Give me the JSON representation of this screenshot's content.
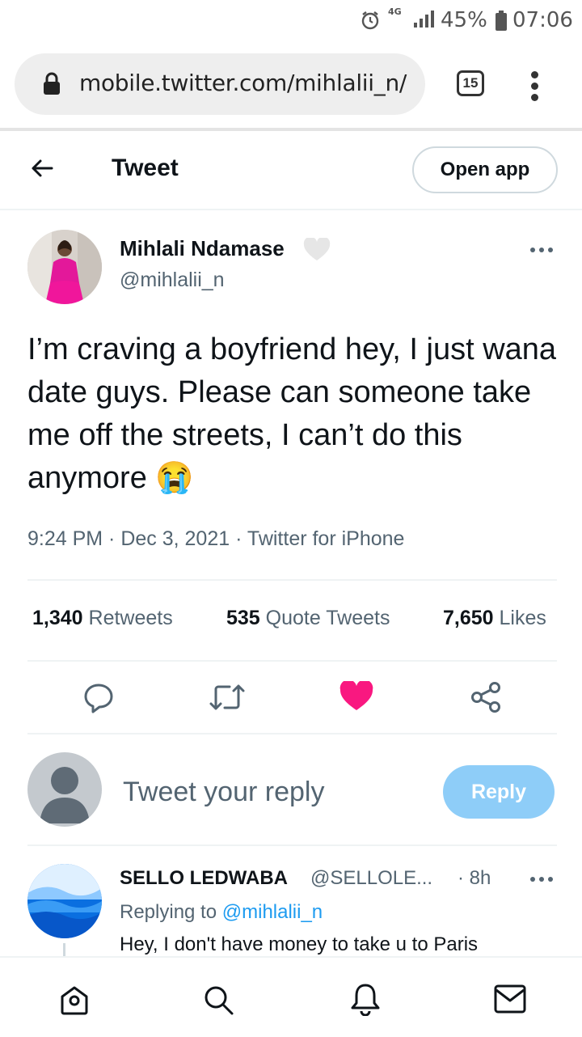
{
  "status_bar": {
    "network": "4G",
    "battery_percent": "45%",
    "time": "07:06"
  },
  "browser": {
    "url": "mobile.twitter.com/mihlalii_n/",
    "tab_count": "15"
  },
  "header": {
    "title": "Tweet",
    "open_app_label": "Open app"
  },
  "tweet": {
    "author_name": "Mihlali Ndamase",
    "author_handle": "@mihlalii_n",
    "text": "I’m craving a boyfriend hey, I just wana date guys. Please can someone take me off the streets, I can’t do this anymore",
    "emoji": "😭",
    "time": "9:24 PM",
    "date": "Dec 3, 2021",
    "source": "Twitter for iPhone",
    "retweets_count": "1,340",
    "retweets_label": "Retweets",
    "quotes_count": "535",
    "quotes_label": "Quote Tweets",
    "likes_count": "7,650",
    "likes_label": "Likes",
    "liked": true,
    "like_color": "#f91880"
  },
  "reply_box": {
    "placeholder": "Tweet your reply",
    "reply_label": "Reply",
    "reply_button_color": "#8ecdf8"
  },
  "reply": {
    "author_name": "SELLO LEDWABA",
    "author_handle": "@SELLOLE...",
    "time": "· 8h",
    "replying_prefix": "Replying to",
    "replying_to": "@mihlalii_n",
    "text": "Hey, I don't have money to take u to Paris"
  },
  "bottom_nav": {
    "items": [
      "home-icon",
      "search-icon",
      "notifications-icon",
      "messages-icon"
    ]
  },
  "colors": {
    "accent": "#1d9bf0",
    "secondary_text": "#536471"
  }
}
